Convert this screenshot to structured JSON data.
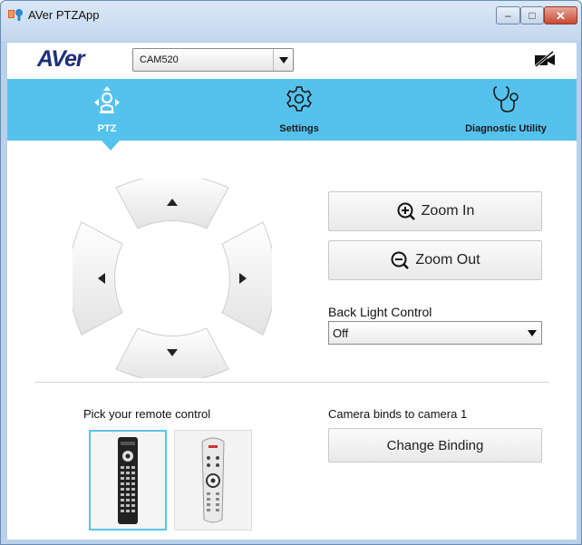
{
  "window": {
    "title": "AVer PTZApp",
    "controls": {
      "minimize": "–",
      "maximize": "□",
      "close": "✕"
    }
  },
  "header": {
    "logo": "AVer",
    "camera_select": {
      "value": "CAM520"
    },
    "camera_status_icon": "camera-off-icon"
  },
  "nav": {
    "tabs": [
      {
        "label": "PTZ",
        "icon": "ptz-icon",
        "active": true
      },
      {
        "label": "Settings",
        "icon": "gear-icon",
        "active": false
      },
      {
        "label": "Diagnostic Utility",
        "icon": "stethoscope-icon",
        "active": false
      }
    ]
  },
  "ptz": {
    "zoom_in": "Zoom In",
    "zoom_out": "Zoom Out",
    "back_light": {
      "label": "Back Light Control",
      "value": "Off"
    }
  },
  "remote": {
    "label": "Pick your remote control",
    "options": [
      {
        "name": "remote-1",
        "selected": true
      },
      {
        "name": "remote-2",
        "selected": false
      }
    ]
  },
  "binding": {
    "label": "Camera binds to camera 1",
    "button": "Change Binding"
  },
  "colors": {
    "accent": "#55c2ee",
    "logo": "#1d2f7a",
    "selected_border": "#5cc3ef"
  }
}
